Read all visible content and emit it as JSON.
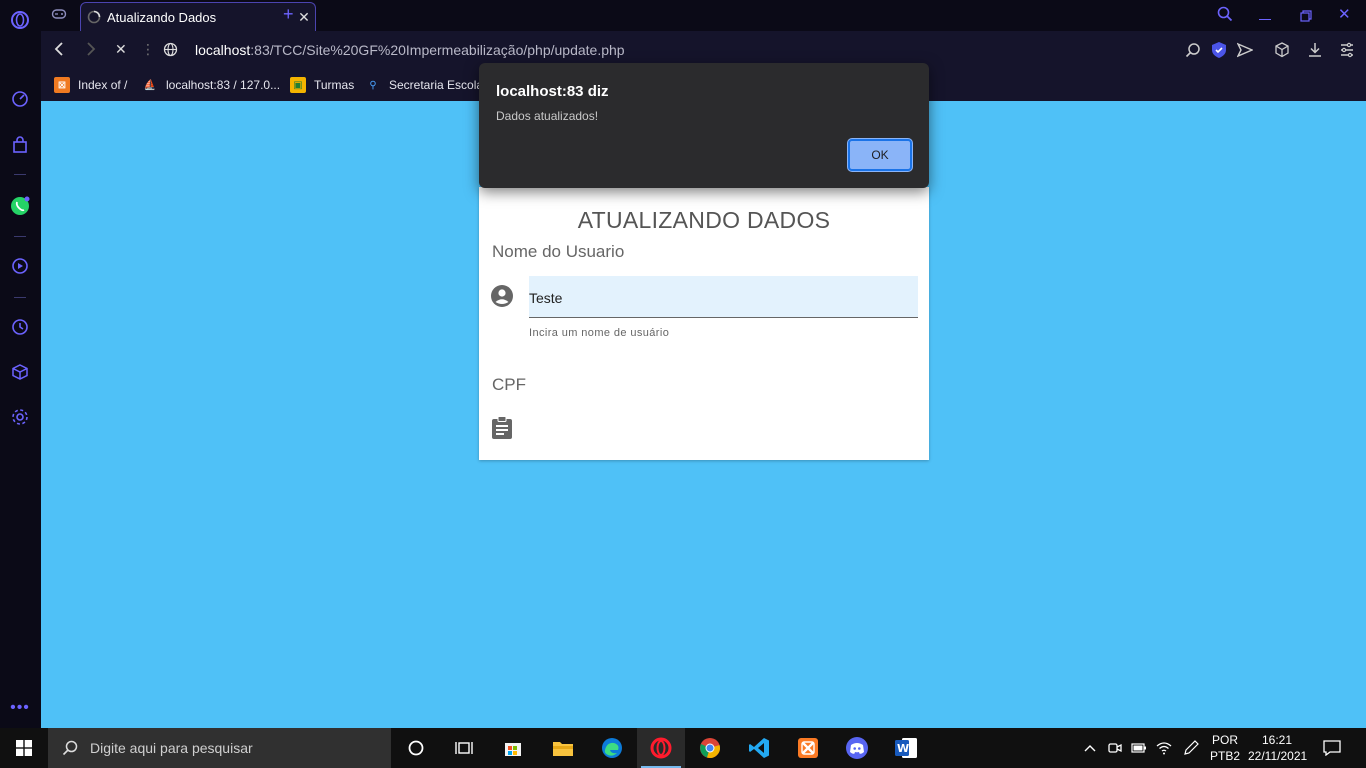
{
  "browser": {
    "tab_title": "Atualizando Dados",
    "url_host": "localhost",
    "url_rest": ":83/TCC/Site%20GF%20Impermeabilização/php/update.php"
  },
  "bookmarks": [
    {
      "label": "Index of /",
      "icon": "xampp-icon"
    },
    {
      "label": "localhost:83 / 127.0...",
      "icon": "phpmyadmin-icon"
    },
    {
      "label": "Turmas",
      "icon": "classroom-icon"
    },
    {
      "label": "Secretaria Escolar",
      "icon": "school-icon"
    }
  ],
  "form": {
    "title": "ATUALIZANDO DADOS",
    "name_label": "Nome do Usuario",
    "name_value": "Teste",
    "name_hint": "Incira um nome de usuário",
    "cpf_label": "CPF"
  },
  "alert": {
    "title": "localhost:83 diz",
    "message": "Dados atualizados!",
    "ok_label": "OK"
  },
  "taskbar": {
    "search_placeholder": "Digite aqui para pesquisar",
    "lang_top": "POR",
    "lang_bottom": "PTB2",
    "time": "16:21",
    "date": "22/11/2021"
  },
  "colors": {
    "page_bg": "#4fc1f7",
    "browser_bg": "#15142b",
    "accent": "#4b44b0",
    "ok_button": "#8ab4f8"
  }
}
